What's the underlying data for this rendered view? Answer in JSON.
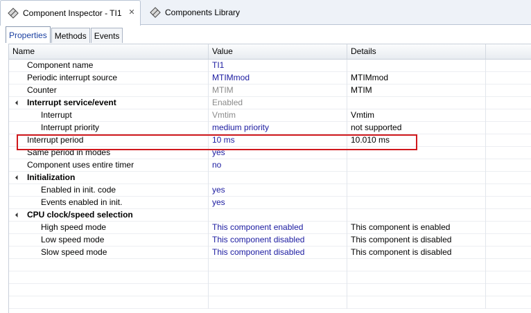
{
  "editor_tabs": [
    {
      "label": "Component Inspector - TI1",
      "icon": "component-chip-icon",
      "active": true
    },
    {
      "label": "Components Library",
      "icon": "component-chip-icon",
      "active": false
    }
  ],
  "sub_tabs": [
    "Properties",
    "Methods",
    "Events"
  ],
  "columns": {
    "name": "Name",
    "value": "Value",
    "details": "Details"
  },
  "rows": [
    {
      "name": "Component name",
      "value": "TI1",
      "details": ""
    },
    {
      "name": "Periodic interrupt source",
      "value": "MTIMmod",
      "details": "MTIMmod"
    },
    {
      "name": "Counter",
      "value": "MTIM",
      "details": "MTIM"
    },
    {
      "name": "Interrupt service/event",
      "value": "Enabled",
      "details": ""
    },
    {
      "name": "Interrupt",
      "value": "Vmtim",
      "details": "Vmtim"
    },
    {
      "name": "Interrupt priority",
      "value": "medium priority",
      "details": "not supported"
    },
    {
      "name": "Interrupt period",
      "value": "10 ms",
      "details": "10.010 ms"
    },
    {
      "name": "Same period in modes",
      "value": "yes",
      "details": ""
    },
    {
      "name": "Component uses entire timer",
      "value": "no",
      "details": ""
    },
    {
      "name": "Initialization",
      "value": "",
      "details": ""
    },
    {
      "name": "Enabled in init. code",
      "value": "yes",
      "details": ""
    },
    {
      "name": "Events enabled in init.",
      "value": "yes",
      "details": ""
    },
    {
      "name": "CPU clock/speed selection",
      "value": "",
      "details": ""
    },
    {
      "name": "High speed mode",
      "value": "This component enabled",
      "details": "This component is enabled"
    },
    {
      "name": "Low speed mode",
      "value": "This component disabled",
      "details": "This component is disabled"
    },
    {
      "name": "Slow speed mode",
      "value": "This component disabled",
      "details": "This component is disabled"
    }
  ],
  "colors": {
    "value_text": "#1a1aa0",
    "disabled_text": "#8a8a8a",
    "highlight_box": "#d0181c"
  }
}
